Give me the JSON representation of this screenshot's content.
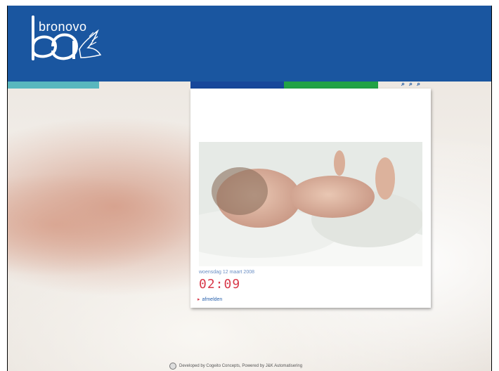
{
  "header": {
    "logo_text": "bronovo",
    "brand_color": "#1a56a0"
  },
  "accent_bars": {
    "teal": "#59b7be",
    "navy": "#17479a",
    "green": "#22a245"
  },
  "toolbar_icons": [
    "search-small-icon",
    "search-medium-icon",
    "search-large-icon"
  ],
  "panel": {
    "date": "woensdag 12 maart 2008",
    "time": "02:09",
    "logout_label": "afmelden"
  },
  "footer": {
    "credit": "Developed by Cogeito Concepts, Powered by J&K Automatisering"
  }
}
